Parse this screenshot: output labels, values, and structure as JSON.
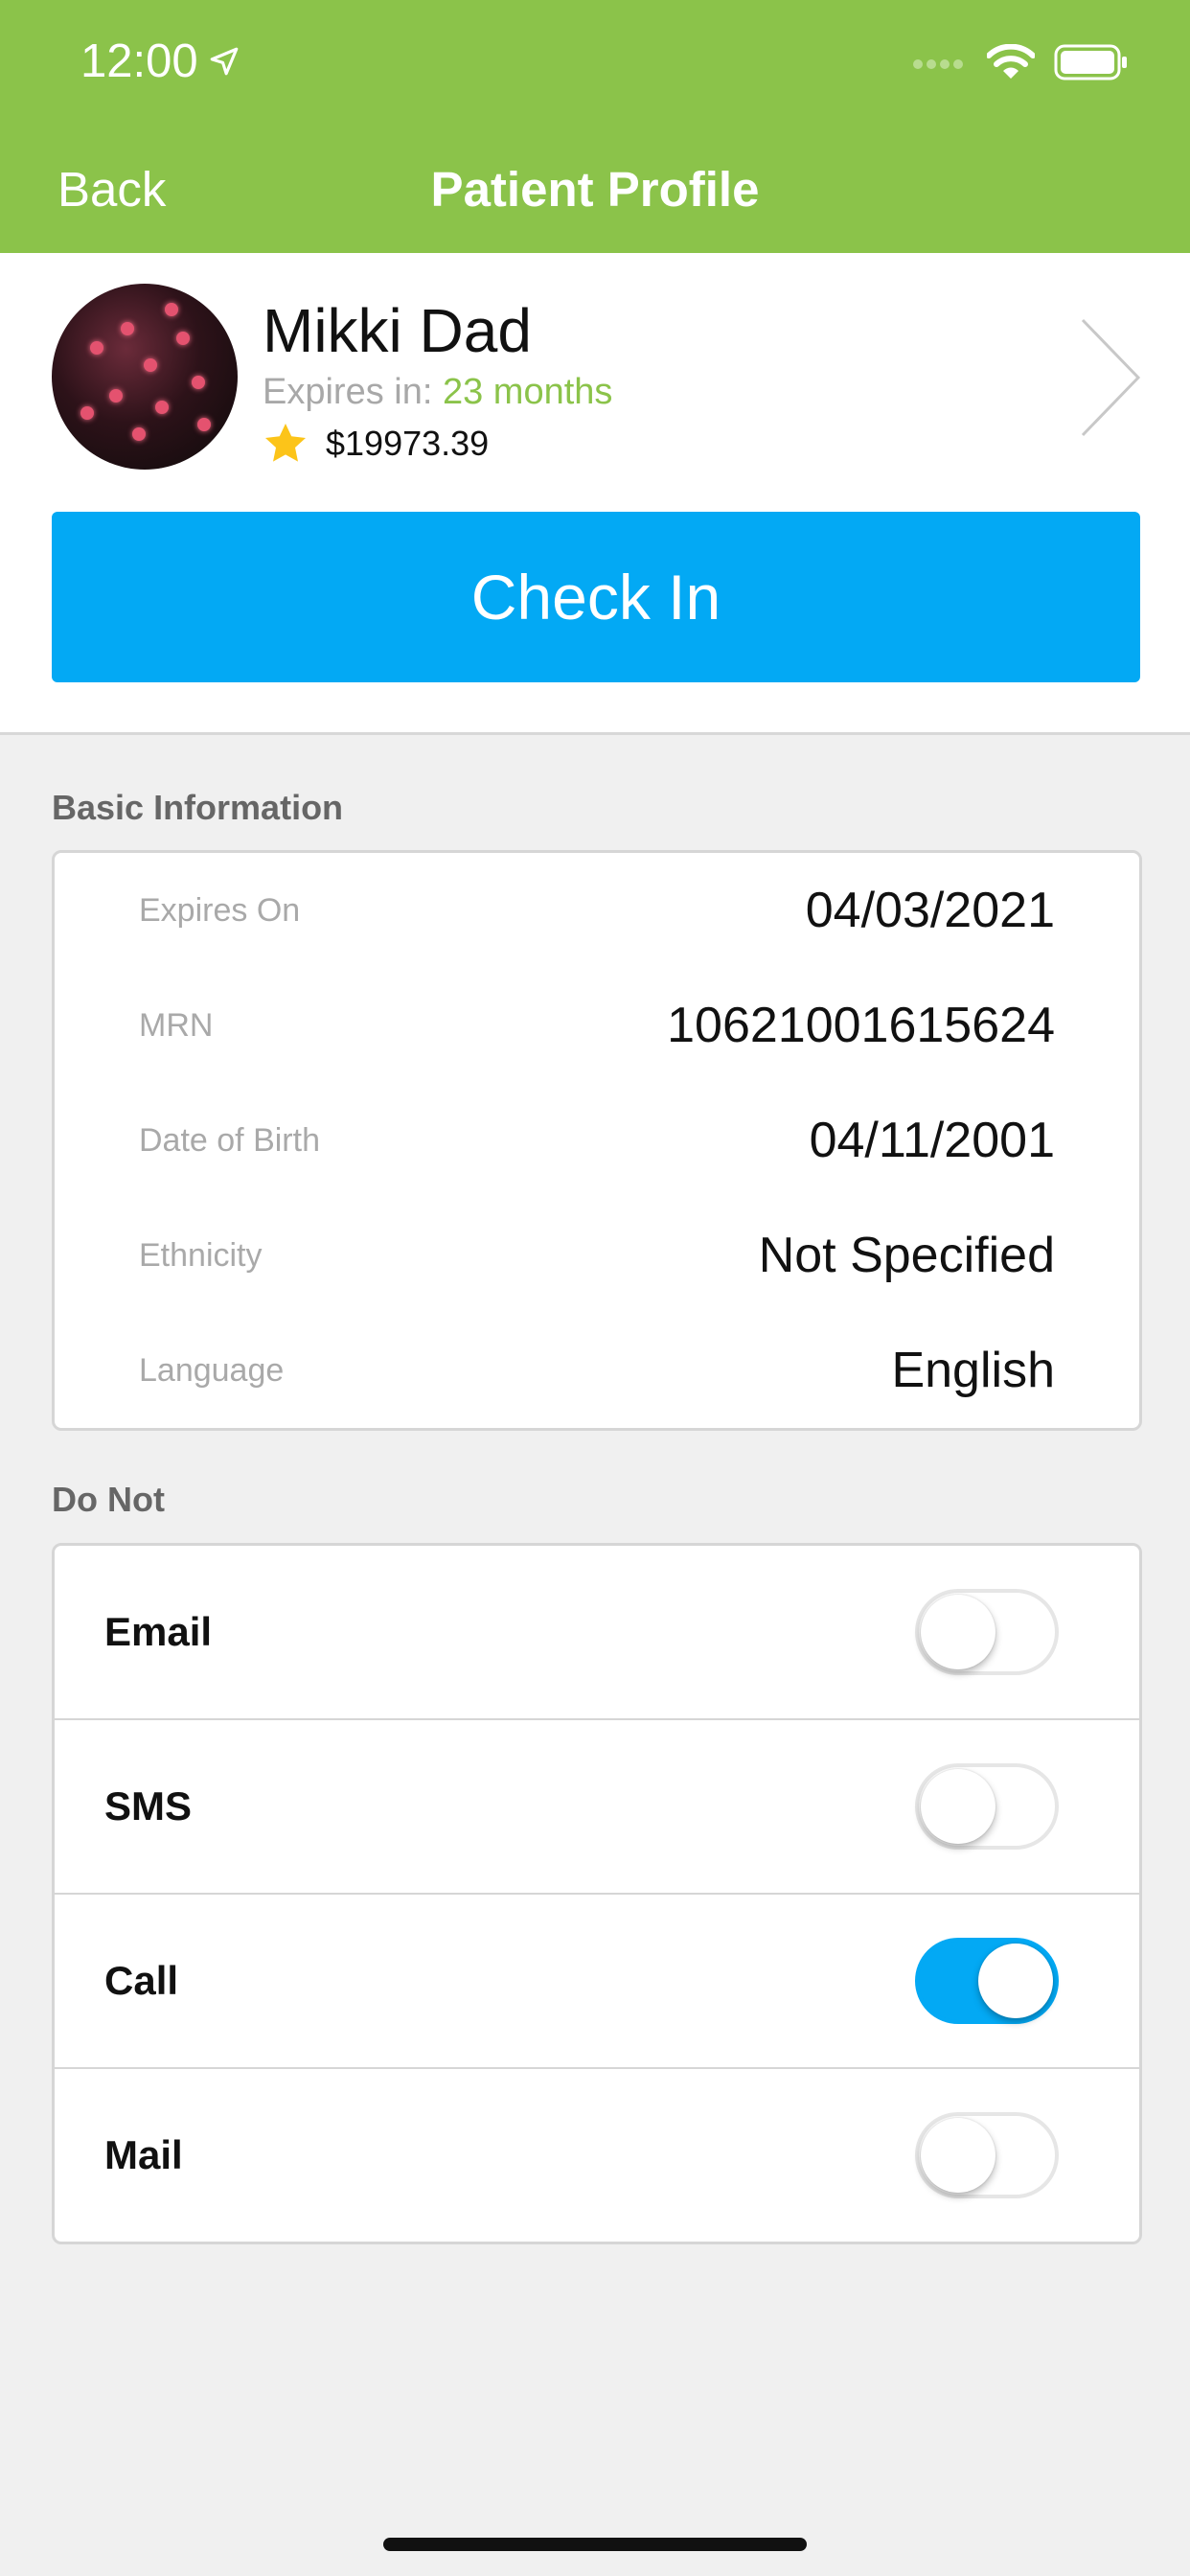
{
  "status_bar": {
    "time": "12:00"
  },
  "nav": {
    "back_label": "Back",
    "title": "Patient Profile"
  },
  "profile": {
    "name": "Mikki Dad",
    "expires_label": "Expires in:",
    "expires_value": "23 months",
    "balance": "$19973.39"
  },
  "check_in_label": "Check In",
  "basic_info": {
    "title": "Basic Information",
    "rows": [
      {
        "label": "Expires On",
        "value": "04/03/2021"
      },
      {
        "label": "MRN",
        "value": "10621001615624"
      },
      {
        "label": "Date of Birth",
        "value": "04/11/2001"
      },
      {
        "label": "Ethnicity",
        "value": "Not Specified"
      },
      {
        "label": "Language",
        "value": "English"
      }
    ]
  },
  "do_not": {
    "title": "Do Not",
    "rows": [
      {
        "label": "Email",
        "on": false
      },
      {
        "label": "SMS",
        "on": false
      },
      {
        "label": "Call",
        "on": true
      },
      {
        "label": "Mail",
        "on": false
      }
    ]
  },
  "colors": {
    "header": "#8bc34a",
    "accent": "#03a9f4",
    "expires_value": "#8bc34a",
    "star": "#fcc419"
  },
  "icons": [
    "location-arrow-icon",
    "signal-icon",
    "wifi-icon",
    "battery-icon",
    "star-icon",
    "chevron-right-icon"
  ]
}
